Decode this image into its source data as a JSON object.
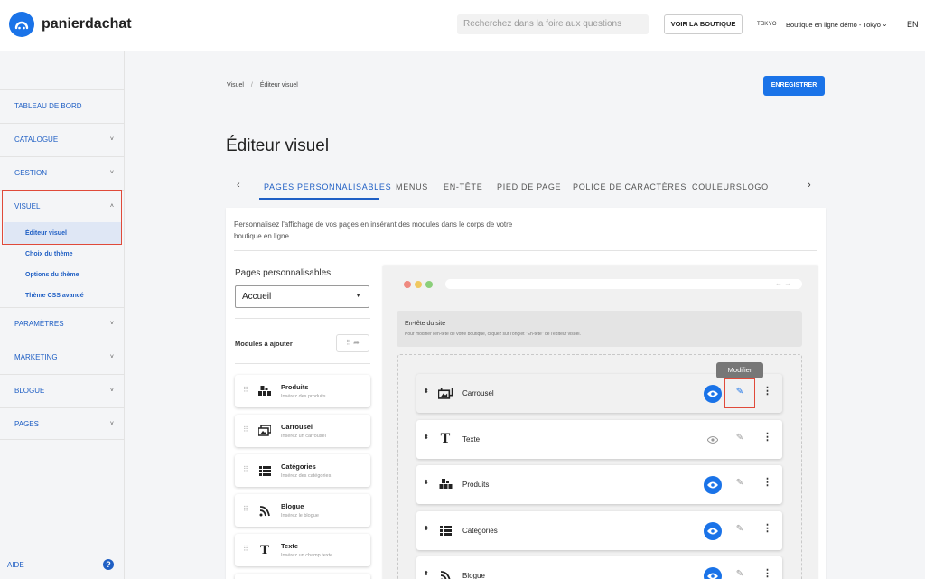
{
  "brand": {
    "name": "panierdachat",
    "accent": "#1a73e8",
    "highlight": "#e04a3a"
  },
  "topbar": {
    "search_placeholder": "Recherchez dans la foire aux questions",
    "view_store": "VOIR LA BOUTIQUE",
    "store_logo": "TƎKYO",
    "store_name": "Boutique en ligne démo - Tokyo",
    "language": "EN"
  },
  "sidebar": {
    "items": [
      {
        "label": "TABLEAU DE BORD"
      },
      {
        "label": "CATALOGUE"
      },
      {
        "label": "GESTION"
      },
      {
        "label": "VISUEL"
      },
      {
        "label": "PARAMÈTRES"
      },
      {
        "label": "MARKETING"
      },
      {
        "label": "BLOGUE"
      },
      {
        "label": "PAGES"
      }
    ],
    "subitems": [
      {
        "label": "Éditeur visuel",
        "active": true
      },
      {
        "label": "Choix du thème"
      },
      {
        "label": "Options du thème"
      },
      {
        "label": "Thème CSS avancé"
      }
    ],
    "help": "AIDE"
  },
  "breadcrumb": {
    "root": "Visuel",
    "separator": "/",
    "current": "Éditeur visuel"
  },
  "save_label": "ENREGISTRER",
  "page_title": "Éditeur visuel",
  "tabs": [
    {
      "label": "PAGES PERSONNALISABLES",
      "active": true
    },
    {
      "label": "MENUS"
    },
    {
      "label": "EN-TÊTE"
    },
    {
      "label": "PIED DE PAGE"
    },
    {
      "label": "POLICE DE CARACTÈRES"
    },
    {
      "label": "COULEURS"
    },
    {
      "label": "LOGO"
    }
  ],
  "description": "Personnalisez l'affichage de vos pages en insérant des modules dans le corps de votre boutique en ligne",
  "pages_select": {
    "label": "Pages personnalisables",
    "value": "Accueil"
  },
  "modules": {
    "title": "Modules à ajouter",
    "items": [
      {
        "name": "Produits",
        "desc": "Insérez des produits",
        "icon": "products-icon"
      },
      {
        "name": "Carrousel",
        "desc": "Insérez un carrousel",
        "icon": "carousel-icon"
      },
      {
        "name": "Catégories",
        "desc": "Insérez des catégories",
        "icon": "categories-icon"
      },
      {
        "name": "Blogue",
        "desc": "Insérez le blogue",
        "icon": "blog-icon"
      },
      {
        "name": "Texte",
        "desc": "Insérez un champ texte",
        "icon": "text-icon"
      }
    ]
  },
  "preview": {
    "header_title": "En-tête du site",
    "header_sub": "Pour modifier l'en-tête de votre boutique, cliquez sur l'onglet \"En-tête\" de l'éditeur visuel.",
    "tooltip": "Modifier",
    "rows": [
      {
        "name": "Carrousel",
        "icon": "carousel-icon",
        "visible": true
      },
      {
        "name": "Texte",
        "icon": "text-icon",
        "visible": false
      },
      {
        "name": "Produits",
        "icon": "products-icon",
        "visible": true
      },
      {
        "name": "Catégories",
        "icon": "categories-icon",
        "visible": true
      },
      {
        "name": "Blogue",
        "icon": "blog-icon",
        "visible": true
      }
    ]
  }
}
